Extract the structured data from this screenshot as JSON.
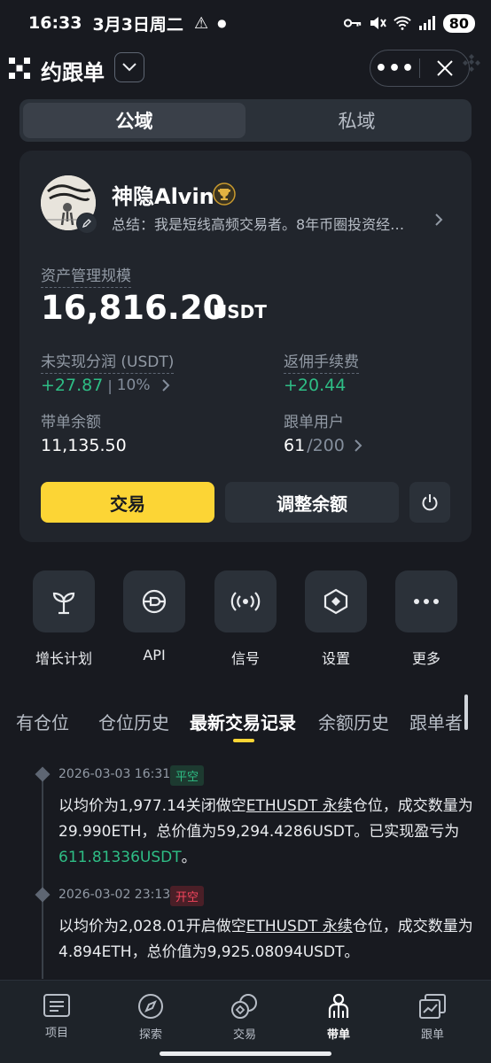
{
  "status_bar": {
    "time": "16:33",
    "date": "3月3日周二",
    "battery": "80"
  },
  "header": {
    "title": "约跟单",
    "dropdown_icon": "chevron-down-icon",
    "more_icon": "more-dots-icon",
    "close_icon": "close-icon"
  },
  "segment": {
    "tabs": [
      "公域",
      "私域"
    ],
    "active": "公域"
  },
  "trader": {
    "name": "神隐Alvin",
    "summary": "总结：我是短线高频交易者。8年币圈投资经…",
    "aum_label": "资产管理规模",
    "aum_value": "16,816.20",
    "aum_unit": "USDT",
    "unrealized_label": "未实现分润 (USDT)",
    "unrealized_value": "+27.87",
    "unrealized_sep": "|",
    "unrealized_pct": "10%",
    "rebate_label": "返佣手续费",
    "rebate_value": "+20.44",
    "balance_label": "带单余额",
    "balance_value": "11,135.50",
    "copiers_label": "跟单用户",
    "copiers_value": "61",
    "copiers_max": "/200"
  },
  "buttons": {
    "trade": "交易",
    "adjust": "调整余额"
  },
  "actions": [
    {
      "label": "增长计划",
      "icon": "sprout-icon"
    },
    {
      "label": "API",
      "icon": "api-plug-icon"
    },
    {
      "label": "信号",
      "icon": "signal-broadcast-icon"
    },
    {
      "label": "设置",
      "icon": "settings-hex-icon"
    },
    {
      "label": "更多",
      "icon": "more-dots-icon"
    }
  ],
  "subtabs": [
    "持有仓位",
    "仓位历史",
    "最新交易记录",
    "余额历史",
    "跟单者"
  ],
  "subtabs_partial": {
    "first_visible": "有仓位"
  },
  "active_subtab": "最新交易记录",
  "records": [
    {
      "time": "2026-03-03 16:31",
      "tag": "平空",
      "text_a": "以均价为1,977.14关闭做空",
      "symbol": "ETHUSDT 永续",
      "text_b": "仓位，成交数量为29.990ETH，总价值为59,294.4286USDT。已实现盈亏为",
      "pnl": "611.81336USDT",
      "text_c": "。"
    },
    {
      "time": "2026-03-02 23:13",
      "tag": "开空",
      "text_a": "以均价为2,028.01开启做空",
      "symbol": "ETHUSDT 永续",
      "text_b": "仓位，成交数量为4.894ETH，总价值为9,925.08094USDT。"
    }
  ],
  "bottom_nav": [
    {
      "label": "项目",
      "icon": "list-icon"
    },
    {
      "label": "探索",
      "icon": "compass-icon"
    },
    {
      "label": "交易",
      "icon": "exchange-icon"
    },
    {
      "label": "带单",
      "icon": "lead-trader-icon"
    },
    {
      "label": "跟单",
      "icon": "copy-chart-icon"
    }
  ],
  "bottom_nav_active": "带单",
  "colors": {
    "accent": "#fcd535",
    "positive": "#2ebd85",
    "negative": "#f6465d",
    "background": "#181a20",
    "card": "#21252c"
  }
}
